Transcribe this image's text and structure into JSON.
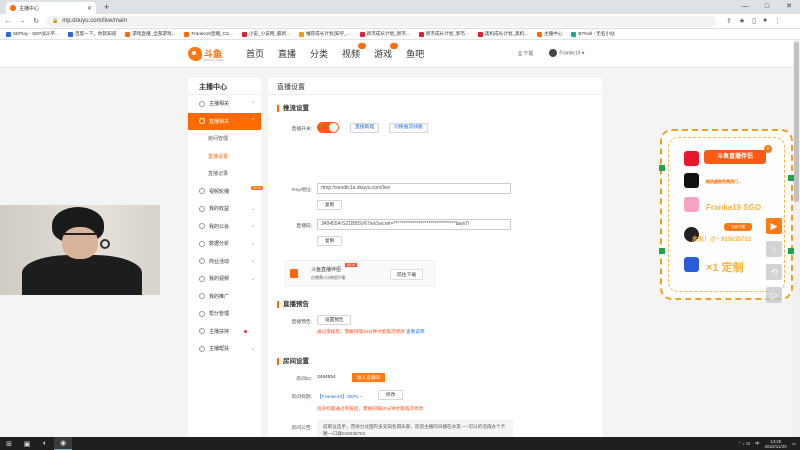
{
  "browser": {
    "tab_title": "主播中心",
    "new_tab": "+",
    "url": "mp.douyu.com/live/main",
    "window_controls": [
      "—",
      "□",
      "✕"
    ],
    "bookmarks": [
      {
        "label": "SEPlay - SEP战斗平...",
        "color": "#2b6bd6"
      },
      {
        "label": "百度一下，你就知道",
        "color": "#2f63e0"
      },
      {
        "label": "游戏直播_全部游戏...",
        "color": "#ff6a00"
      },
      {
        "label": "Franke19直播_CS...",
        "color": "#ff6a00"
      },
      {
        "label": "小说_小说网_最新...",
        "color": "#d23"
      },
      {
        "label": "推荐成长计划(知乎_...",
        "color": "#f39c12"
      },
      {
        "label": "新杰成长计划_新杰...",
        "color": "#d23"
      },
      {
        "label": "新杰成长计划_新杰...",
        "color": "#d23"
      },
      {
        "label": "黑机成长计划_黑机...",
        "color": "#d23"
      },
      {
        "label": "主播中心",
        "color": "#ff6a00"
      },
      {
        "label": "BTNull - 无名小站",
        "color": "#2a9"
      }
    ]
  },
  "site": {
    "logo_text": "斗鱼",
    "logo_sub": "DOUYU.COM",
    "nav": [
      "首页",
      "直播",
      "分类",
      "视频",
      "游戏",
      "鱼吧"
    ],
    "download": "下载",
    "username": "Franke19 ▾"
  },
  "sidebar": {
    "title": "主播中心",
    "items": [
      {
        "label": "主播相关"
      },
      {
        "label": "直播相关"
      },
      {
        "label": "房间管理"
      },
      {
        "label": "直播设置"
      },
      {
        "label": "直播记录"
      },
      {
        "label": "视频轮播",
        "badge": "NEW"
      },
      {
        "label": "我的收益"
      },
      {
        "label": "我的公会"
      },
      {
        "label": "数据分析"
      },
      {
        "label": "商业活动"
      },
      {
        "label": "我的视频"
      },
      {
        "label": "我的推广"
      },
      {
        "label": "帮分管理"
      },
      {
        "label": "主播扶持"
      },
      {
        "label": "主播帮扶"
      }
    ]
  },
  "main": {
    "page_title": "直播设置",
    "stream_section": "推流设置",
    "switch_label": "直播开关:",
    "btn_live_assistant": "直播助理",
    "btn_switch_line": "切换推流线路",
    "rtmp_label": "rtmp地址:",
    "rtmp_value": "rtmp://sendtc1a.douyu.com/live",
    "copy": "复制",
    "code_label": "直播码:",
    "code_value": "3494554rS21BBSV67wsSecret=********************************&wsTi",
    "assistant_name": "斗鱼直播伴侣",
    "assistant_new": "NEW",
    "assistant_desc": "仅需需1分钟就开播",
    "assistant_download": "前往下载",
    "preview_section": "直播预告",
    "preview_label": "直播预告:",
    "preview_btn": "设置预告",
    "preview_warn": "通过审核后，需要间隔10分钟才能再次修改",
    "preview_link": "查看说明",
    "room_section": "房间设置",
    "room_id_label": "房间ID:",
    "room_id": "3494554",
    "enter_room": "进入直播间",
    "room_title_label": "房间标题:",
    "room_title": "【Franke19】SEPL~",
    "modify": "修改",
    "room_title_warn": "房间标题通过审核后，需要间隔10分钟才能再次修改",
    "notice_label": "房间公告:",
    "notice_text": "前职业选手，曾效力过国内多支知名俱乐部，欢迎主播的日播在水友-----可以的话再办个卡喔~~口群915035753"
  },
  "ad": {
    "title": "斗鱼直播伴侣",
    "line1": "刷热度刷免费热门...",
    "line2": "Franke19 SGO",
    "line3": "水友！@~ 915035753",
    "line4": "×1 定制",
    "close": "×",
    "cta": "立即下载"
  },
  "float_buttons": [
    "▶",
    "⌂",
    "⟲",
    "▷"
  ],
  "taskbar": {
    "time": "14:25",
    "date": "2022/11/20",
    "lang": "中"
  }
}
